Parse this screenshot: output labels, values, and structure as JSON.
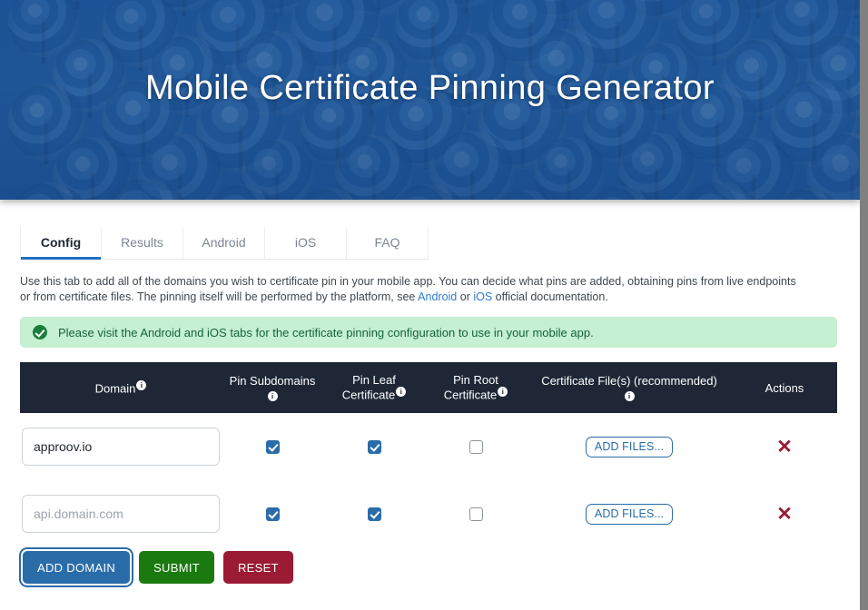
{
  "hero": {
    "title": "Mobile Certificate Pinning Generator",
    "bg_color": "#1f5596"
  },
  "tabs": [
    {
      "label": "Config",
      "active": true
    },
    {
      "label": "Results",
      "active": false
    },
    {
      "label": "Android",
      "active": false
    },
    {
      "label": "iOS",
      "active": false
    },
    {
      "label": "FAQ",
      "active": false
    }
  ],
  "description": {
    "part1": "Use this tab to add all of the domains you wish to certificate pin in your mobile app. You can decide what pins are added, obtaining pins from live endpoints or from certificate files. The pinning itself will be performed by the platform, see ",
    "link_android": "Android",
    "mid": " or ",
    "link_ios": "iOS",
    "part2": " official documentation."
  },
  "alert": {
    "icon": "check-circle-icon",
    "message": "Please visit the Android and iOS tabs for the certificate pinning configuration to use in your mobile app.",
    "bg_color": "#c5f0d2",
    "text_color": "#17633a"
  },
  "table": {
    "header_bg": "#1f2736",
    "columns": [
      {
        "label": "Domain",
        "info": true
      },
      {
        "label": "Pin Subdomains",
        "info": true
      },
      {
        "label": "Pin Leaf Certificate",
        "info": true
      },
      {
        "label": "Pin Root Certificate",
        "info": true
      },
      {
        "label": "Certificate File(s) (recommended)",
        "info": true
      },
      {
        "label": "Actions",
        "info": false
      }
    ],
    "rows": [
      {
        "domain_value": "approov.io",
        "domain_placeholder": "api.domain.com",
        "pin_subdomains": true,
        "pin_leaf": true,
        "pin_root": false,
        "add_files_label": "ADD FILES...",
        "delete_label": "✕"
      },
      {
        "domain_value": "",
        "domain_placeholder": "api.domain.com",
        "pin_subdomains": true,
        "pin_leaf": true,
        "pin_root": false,
        "add_files_label": "ADD FILES...",
        "delete_label": "✕"
      }
    ]
  },
  "buttons": {
    "add_domain": "ADD DOMAIN",
    "submit": "SUBMIT",
    "reset": "RESET",
    "add_domain_color": "#2a6ca8",
    "submit_color": "#1a7a10",
    "reset_color": "#9b1b34"
  }
}
